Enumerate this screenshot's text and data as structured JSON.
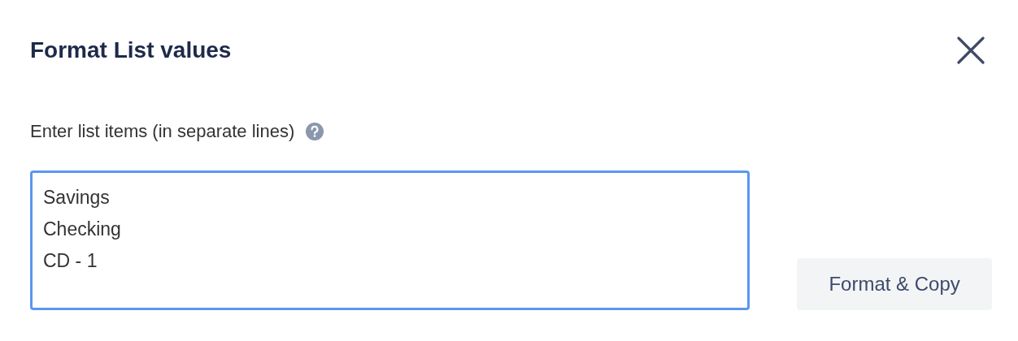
{
  "dialog": {
    "title": "Format List values"
  },
  "field": {
    "label": "Enter list items (in separate lines)",
    "value": "Savings\nChecking\nCD - 1",
    "focused": true
  },
  "buttons": [
    {
      "label": "Format & Copy"
    }
  ]
}
